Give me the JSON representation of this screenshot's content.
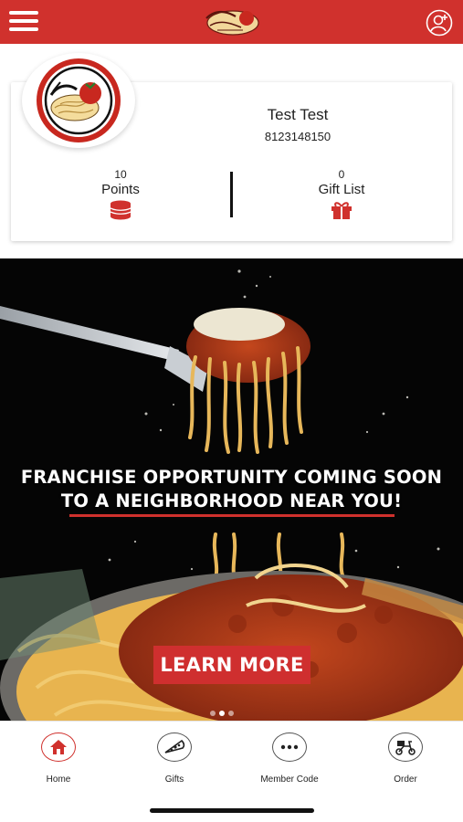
{
  "header": {
    "menu_icon": "hamburger-icon",
    "logo": "squisito-logo",
    "profile_icon": "user-add-icon"
  },
  "profile": {
    "name": "Test Test",
    "phone": "8123148150",
    "points": {
      "value": "10",
      "label": "Points",
      "icon": "coin-stack-icon"
    },
    "gifts": {
      "value": "0",
      "label": "Gift List",
      "icon": "gift-icon"
    }
  },
  "banner": {
    "headline_line1": "FRANCHISE OPPORTUNITY COMING SOON",
    "headline_line2": "TO A NEIGHBORHOOD NEAR YOU!",
    "button_label": "LEARN MORE",
    "slides_count": 3,
    "active_slide": 2
  },
  "bottom_nav": {
    "items": [
      {
        "label": "Home",
        "icon": "home-icon",
        "active": true
      },
      {
        "label": "Gifts",
        "icon": "pizza-slice-icon",
        "active": false
      },
      {
        "label": "Member Code",
        "icon": "dots-icon",
        "active": false
      },
      {
        "label": "Order",
        "icon": "scooter-icon",
        "active": false
      }
    ]
  },
  "colors": {
    "brand_red": "#d0312d",
    "text": "#222222",
    "banner_bg": "#050505"
  }
}
